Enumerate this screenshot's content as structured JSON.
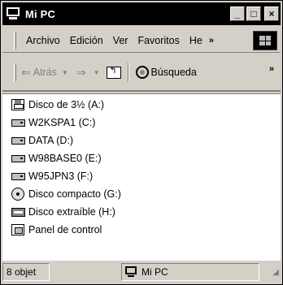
{
  "window": {
    "title": "Mi PC",
    "buttons": {
      "minimize": "_",
      "maximize": "□",
      "close": "×"
    }
  },
  "menubar": {
    "items": [
      "Archivo",
      "Edición",
      "Ver",
      "Favoritos",
      "He"
    ],
    "overflow": "»"
  },
  "toolbar": {
    "back_label": "Atrás",
    "search_label": "Búsqueda",
    "overflow": "»"
  },
  "files": [
    {
      "name": "Disco de 3½ (A:)",
      "icon": "floppy-drive-icon"
    },
    {
      "name": "W2KSPA1 (C:)",
      "icon": "hard-drive-icon"
    },
    {
      "name": "DATA (D:)",
      "icon": "hard-drive-icon"
    },
    {
      "name": "W98BASE0 (E:)",
      "icon": "hard-drive-icon"
    },
    {
      "name": "W95JPN3 (F:)",
      "icon": "hard-drive-icon"
    },
    {
      "name": "Disco compacto (G:)",
      "icon": "cd-drive-icon"
    },
    {
      "name": "Disco extraíble (H:)",
      "icon": "removable-drive-icon"
    },
    {
      "name": "Panel de control",
      "icon": "control-panel-icon"
    }
  ],
  "statusbar": {
    "count": "8 objet",
    "location": "Mi PC"
  }
}
